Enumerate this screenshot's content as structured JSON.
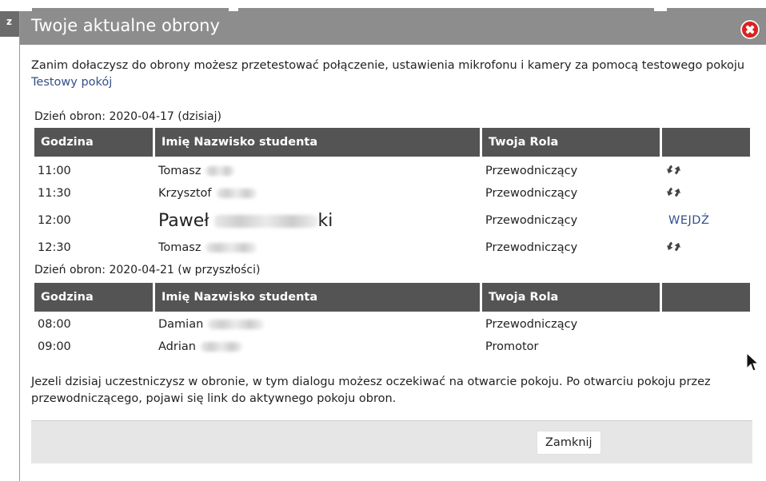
{
  "background": {
    "tab_label": "z"
  },
  "dialog": {
    "title": "Twoje aktualne obrony",
    "intro_text": "Zanim dołaczysz do obrony możesz przetestować połączenie, ustawienia mikrofonu i kamery za pomocą testowego pokoju",
    "intro_link": "Testowy pokój",
    "columns": [
      "Godzina",
      "Imię Nazwisko studenta",
      "Twoja Rola",
      ""
    ],
    "days": [
      {
        "header": "Dzień obron: 2020-04-17 (dzisiaj)",
        "rows": [
          {
            "time": "11:00",
            "student": "Tomasz",
            "role": "Przewodniczący",
            "action": "refresh-icon"
          },
          {
            "time": "11:30",
            "student": "Krzysztof",
            "role": "Przewodniczący",
            "action": "refresh-icon"
          },
          {
            "time": "12:00",
            "student": "Paweł",
            "student_suffix": "ki",
            "role": "Przewodniczący",
            "action_label": "WEJDŹ"
          },
          {
            "time": "12:30",
            "student": "Tomasz",
            "role": "Przewodniczący",
            "action": "refresh-icon"
          }
        ]
      },
      {
        "header": "Dzień obron: 2020-04-21 (w przyszłości)",
        "rows": [
          {
            "time": "08:00",
            "student": "Damian",
            "role": "Przewodniczący"
          },
          {
            "time": "09:00",
            "student": "Adrian",
            "role": "Promotor"
          }
        ]
      }
    ],
    "note": "Jezeli dzisiaj uczestniczysz w obronie, w tym dialogu możesz oczekiwać na otwarcie pokoju. Po otwarciu pokoju przez przewodniczącego, pojawi się link do aktywnego pokoju obron.",
    "close_button": "Zamknij"
  },
  "colors": {
    "titlebar": "#8d8d8d",
    "table_header": "#545454",
    "link": "#33508a",
    "close_icon": "#d8231f"
  }
}
